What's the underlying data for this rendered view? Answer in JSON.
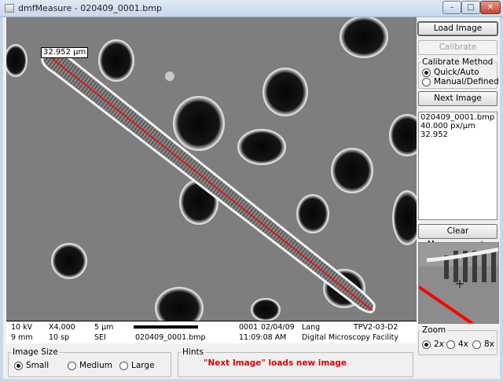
{
  "window": {
    "title": "dmfMeasure - 020409_0001.bmp",
    "controls": {
      "minimize": "–",
      "maximize": "□",
      "close": "✕"
    }
  },
  "image": {
    "measurement_label": "32.952 µm"
  },
  "databar": {
    "voltage": "10 kV",
    "magnification": "X4,000",
    "scale": "5 µm",
    "number": "0001",
    "date": "02/04/09",
    "operator": "Lang",
    "sample": "TPV2-03-D2",
    "wd": "9 mm",
    "scans": "10 sp",
    "detector": "SEI",
    "filename": "020409_0001.bmp",
    "time": "11:09:08 AM",
    "facility": "Digital Microscopy Facility"
  },
  "panel": {
    "load_image": "Load Image",
    "calibrate": "Calibrate",
    "calibrate_method": {
      "title": "Calibrate Method",
      "options": [
        "Quick/Auto",
        "Manual/Defined"
      ],
      "selected": 0
    },
    "next_image": "Next Image",
    "info_lines": [
      "020409_0001.bmp",
      "40.000 px/µm",
      "32.952"
    ],
    "clear_measurements": "Clear Measurements",
    "zoom": {
      "title": "Zoom",
      "options": [
        "2x",
        "4x",
        "8x"
      ],
      "selected": 0
    }
  },
  "bottom": {
    "image_size": {
      "title": "Image Size",
      "options": [
        "Small",
        "Medium",
        "Large"
      ],
      "selected": 0
    },
    "hints": {
      "title": "Hints",
      "text": "\"Next Image\" loads new image"
    }
  },
  "colors": {
    "measure_line": "#ff0000",
    "hint_text": "#e00000"
  }
}
